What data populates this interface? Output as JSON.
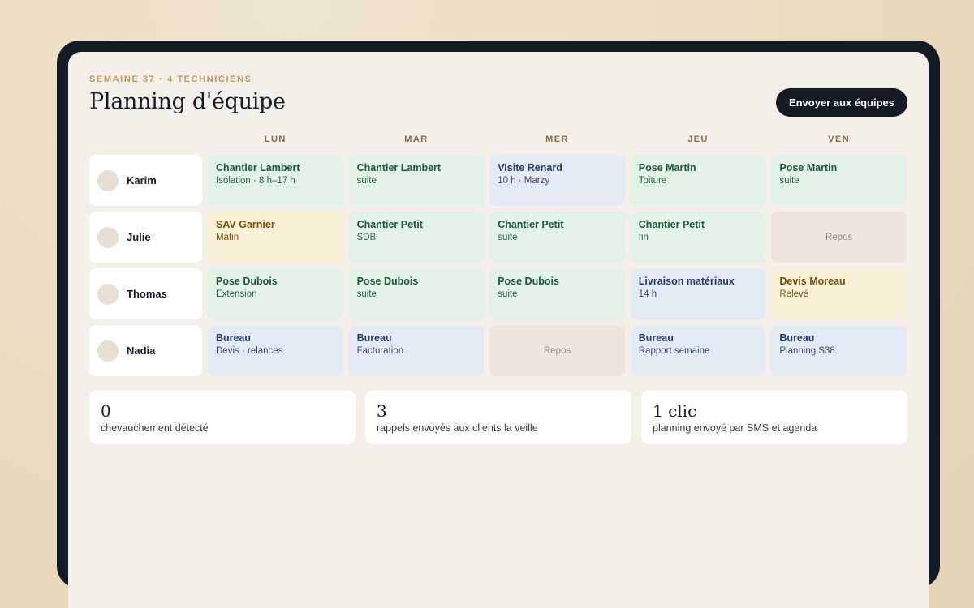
{
  "header": {
    "eyebrow": "SEMAINE 37 · 4 TECHNICIENS",
    "title": "Planning d'équipe",
    "send_button": "Envoyer aux équipes"
  },
  "days": [
    "LUN",
    "MAR",
    "MER",
    "JEU",
    "VEN"
  ],
  "technicians": [
    {
      "name": "Karim",
      "schedule": [
        {
          "type": "green",
          "title": "Chantier Lambert",
          "sub": "Isolation · 8 h–17 h"
        },
        {
          "type": "green",
          "title": "Chantier Lambert",
          "sub": "suite"
        },
        {
          "type": "blue",
          "title": "Visite Renard",
          "sub": "10 h · Marzy"
        },
        {
          "type": "green",
          "title": "Pose Martin",
          "sub": "Toiture"
        },
        {
          "type": "green",
          "title": "Pose Martin",
          "sub": "suite"
        }
      ]
    },
    {
      "name": "Julie",
      "schedule": [
        {
          "type": "yellow",
          "title": "SAV Garnier",
          "sub": "Matin"
        },
        {
          "type": "green",
          "title": "Chantier Petit",
          "sub": "SDB"
        },
        {
          "type": "green",
          "title": "Chantier Petit",
          "sub": "suite"
        },
        {
          "type": "green",
          "title": "Chantier Petit",
          "sub": "fin"
        },
        {
          "type": "rest",
          "title": "Repos",
          "sub": ""
        }
      ]
    },
    {
      "name": "Thomas",
      "schedule": [
        {
          "type": "green",
          "title": "Pose Dubois",
          "sub": "Extension"
        },
        {
          "type": "green",
          "title": "Pose Dubois",
          "sub": "suite"
        },
        {
          "type": "green",
          "title": "Pose Dubois",
          "sub": "suite"
        },
        {
          "type": "blue",
          "title": "Livraison matériaux",
          "sub": "14 h"
        },
        {
          "type": "yellow",
          "title": "Devis Moreau",
          "sub": "Relevé"
        }
      ]
    },
    {
      "name": "Nadia",
      "schedule": [
        {
          "type": "blue",
          "title": "Bureau",
          "sub": "Devis · relances"
        },
        {
          "type": "blue",
          "title": "Bureau",
          "sub": "Facturation"
        },
        {
          "type": "rest",
          "title": "Repos",
          "sub": ""
        },
        {
          "type": "blue",
          "title": "Bureau",
          "sub": "Rapport semaine"
        },
        {
          "type": "blue",
          "title": "Bureau",
          "sub": "Planning S38"
        }
      ]
    }
  ],
  "stats": [
    {
      "value": "0",
      "label": "chevauchement détecté"
    },
    {
      "value": "3",
      "label": "rappels envoyés aux clients la veille"
    },
    {
      "value": "1 clic",
      "label": "planning envoyé par SMS et agenda"
    }
  ],
  "colors": {
    "accent_eyebrow": "#c39a5c",
    "dark": "#141a26",
    "green_cell": "#e2f2e6",
    "blue_cell": "#e4eaf5",
    "yellow_cell": "#faf0d8",
    "rest_cell": "#ede5da"
  }
}
